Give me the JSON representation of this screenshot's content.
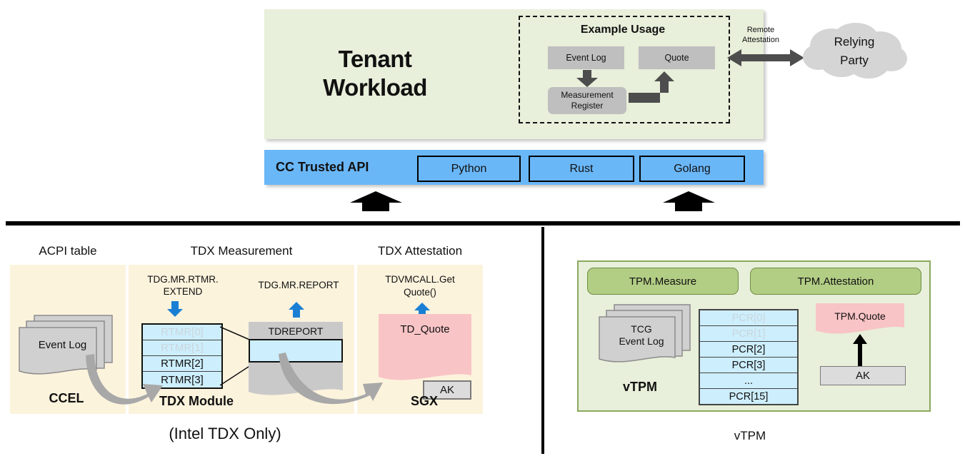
{
  "top": {
    "tenant_title": "Tenant\nWorkload",
    "example": {
      "title": "Example Usage",
      "event_log": "Event Log",
      "quote": "Quote",
      "measurement_register": "Measurement\nRegister"
    },
    "remote_attestation_label": "Remote\nAttestation",
    "relying_party": "Relying\nParty"
  },
  "api_band": {
    "title": "CC Trusted API",
    "languages": [
      "Python",
      "Rust",
      "Golang"
    ]
  },
  "tdx": {
    "section_caption": "(Intel TDX Only)",
    "columns": [
      {
        "title": "ACPI table"
      },
      {
        "title": "TDX Measurement"
      },
      {
        "title": "TDX Attestation"
      }
    ],
    "acpi": {
      "event_log": "Event Log",
      "footer": "CCEL"
    },
    "measurement": {
      "extend_call": "TDG.MR.RTMR.\nEXTEND",
      "report_call": "TDG.MR.REPORT",
      "rtmrs": [
        "RTMR[0]",
        "RTMR[1]",
        "RTMR[2]",
        "RTMR[3]"
      ],
      "rtmr_dim_count": 2,
      "tdreport": "TDREPORT",
      "footer": "TDX Module"
    },
    "attestation": {
      "getquote_call": "TDVMCALL.Get\nQuote()",
      "td_quote": "TD_Quote",
      "ak": "AK",
      "footer": "SGX"
    }
  },
  "vtpm": {
    "caption": "vTPM",
    "pills": [
      "TPM.Measure",
      "TPM.Attestation"
    ],
    "event_log": "TCG\nEvent Log",
    "footer": "vTPM",
    "pcrs": [
      "PCR[0]",
      "PCR[1]",
      "PCR[2]",
      "PCR[3]",
      "...",
      "PCR[15]"
    ],
    "pcr_dim_count": 2,
    "tpm_quote": "TPM.Quote",
    "ak": "AK"
  },
  "colors": {
    "tenant_green": "#e8efda",
    "api_blue": "#6ab7f8",
    "beige": "#fcf3dd",
    "register_blue": "#cdeefc",
    "quote_pink": "#f9c4c6",
    "pill_green": "#b2cd84",
    "doc_gray": "#d0d0d0",
    "arrow_gray": "#4d4d4d"
  }
}
